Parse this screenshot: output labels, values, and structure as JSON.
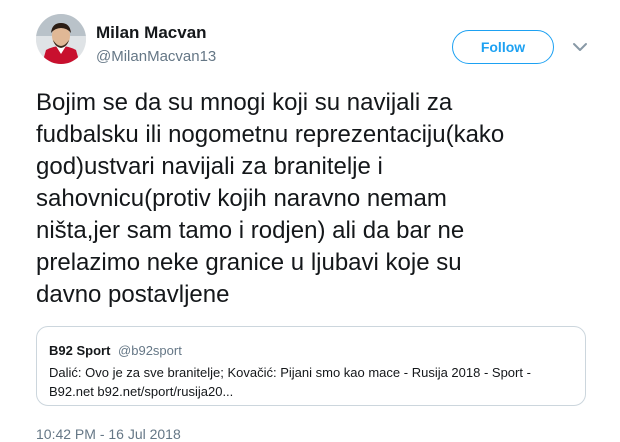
{
  "author": {
    "display_name": "Milan Macvan",
    "handle": "@MilanMacvan13",
    "avatar_icon": "player-avatar"
  },
  "follow_button": {
    "label": "Follow"
  },
  "menu": {
    "icon": "chevron-down-icon"
  },
  "tweet": {
    "lines": [
      "Bojim se da su mnogi koji su navijali za",
      "fudbalsku ili nogometnu reprezentaciju(kako",
      "god)ustvari navijali za branitelje i",
      "sahovnicu(protiv kojih naravno nemam",
      "ništa,jer sam tamo i rodjen) ali da bar ne",
      "prelazimo neke granice u ljubavi koje su",
      "davno postavljene"
    ]
  },
  "quote": {
    "name": "B92 Sport",
    "handle": "@b92sport",
    "line1": "Dalić: Ovo je za sve branitelje; Kovačić: Pijani smo kao mace - Rusija 2018 - Sport -",
    "line2": "B92.net b92.net/sport/rusija20..."
  },
  "timestamp": "10:42 PM - 16 Jul 2018",
  "colors": {
    "accent": "#1da1f2",
    "text": "#14171a",
    "secondary": "#657786",
    "border": "#ccd6dd"
  }
}
